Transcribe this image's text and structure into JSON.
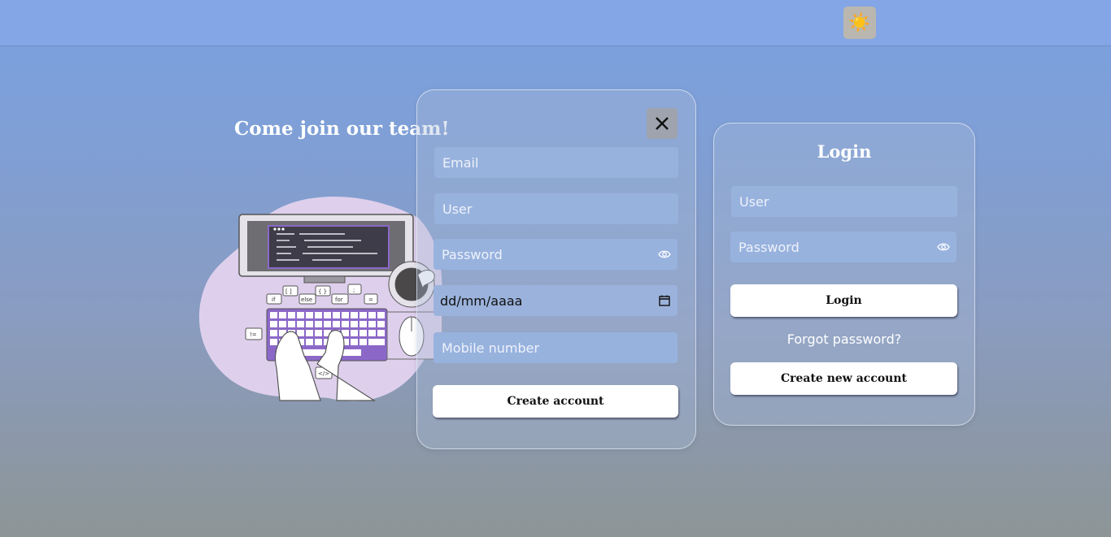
{
  "header": {
    "theme_toggle_icon": "sun-icon",
    "theme_toggle_glyph": "☀️"
  },
  "promo": {
    "headline": "Come join our team!"
  },
  "signup": {
    "email_placeholder": "Email",
    "user_placeholder": "User",
    "password_placeholder": "Password",
    "birthdate_placeholder": "dd/mm/aaaa",
    "mobile_placeholder": "Mobile number",
    "submit_label": "Create account",
    "close_icon": "close-icon"
  },
  "login": {
    "title": "Login",
    "user_placeholder": "User",
    "password_placeholder": "Password",
    "submit_label": "Login",
    "forgot_label": "Forgot password?",
    "create_label": "Create new account"
  },
  "illustration": {
    "tags": [
      "[ ]",
      "{ }",
      ";",
      "if",
      "else",
      "for",
      "=",
      "!=",
      "</>"
    ]
  },
  "colors": {
    "accent_purple": "#8b68c8",
    "blob": "#ded0ec",
    "input_bg": "#98b2de"
  }
}
